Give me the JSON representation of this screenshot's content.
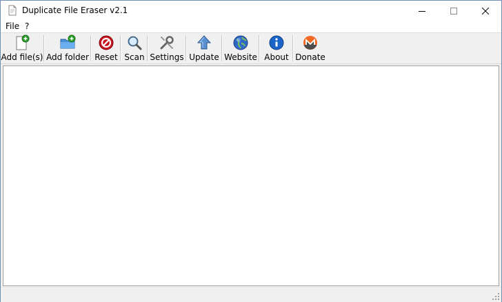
{
  "window": {
    "title": "Duplicate File Eraser v2.1"
  },
  "menu": {
    "items": [
      {
        "label": "File"
      },
      {
        "label": "?"
      }
    ]
  },
  "toolbar": {
    "buttons": [
      {
        "label": "Add file(s)",
        "icon": "add-file-icon"
      },
      {
        "label": "Add folder",
        "icon": "add-folder-icon"
      },
      {
        "label": "Reset",
        "icon": "reset-icon"
      },
      {
        "label": "Scan",
        "icon": "magnifier-icon"
      },
      {
        "label": "Settings",
        "icon": "wrench-icon"
      },
      {
        "label": "Update",
        "icon": "up-arrow-icon"
      },
      {
        "label": "Website",
        "icon": "globe-icon"
      },
      {
        "label": "About",
        "icon": "info-icon"
      },
      {
        "label": "Donate",
        "icon": "monero-icon"
      }
    ]
  },
  "colors": {
    "accent_green": "#2e9e2e",
    "reset_red": "#c8141e",
    "info_blue": "#1a64c8",
    "monero_orange": "#f26822"
  }
}
